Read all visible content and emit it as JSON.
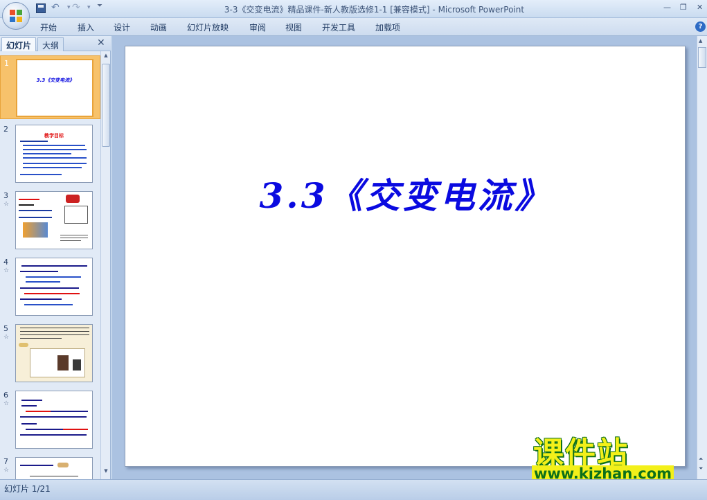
{
  "window": {
    "title": "3-3《交变电流》精品课件-新人教版选修1-1 [兼容模式] - Microsoft PowerPoint",
    "controls": [
      "—",
      "❐",
      "✕"
    ]
  },
  "quick_access": {
    "undo": "↶",
    "redo": "↷"
  },
  "ribbon": {
    "tabs": [
      "开始",
      "插入",
      "设计",
      "动画",
      "幻灯片放映",
      "审阅",
      "视图",
      "开发工具",
      "加载项"
    ],
    "help": "?"
  },
  "left_panel": {
    "tab_slides": "幻灯片",
    "tab_outline": "大纲",
    "close": "✕",
    "thumbnails": [
      {
        "num": "1",
        "title": "3.3《交变电流》",
        "selected": true
      },
      {
        "num": "2",
        "title": "教学目标"
      },
      {
        "num": "3"
      },
      {
        "num": "4"
      },
      {
        "num": "5"
      },
      {
        "num": "6"
      },
      {
        "num": "7"
      }
    ]
  },
  "slide": {
    "title": "3.3《交变电流》"
  },
  "watermark": {
    "brand": "课件站",
    "url": "www.kjzhan.com"
  },
  "status": {
    "slide_counter": "幻灯片 1/21"
  },
  "colors": {
    "accent_blue": "#0a0ae0",
    "selected_thumb": "#f7c26b",
    "ribbon_bg": "#cddcef"
  }
}
